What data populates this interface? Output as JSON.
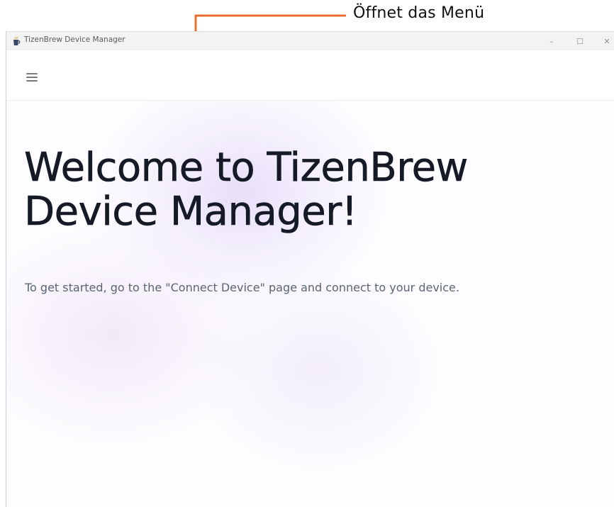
{
  "annotation": {
    "label": "Öffnet das Menü",
    "color": "#e8702f"
  },
  "window": {
    "title": "TizenBrew Device Manager",
    "controls": {
      "minimize": "–",
      "maximize": "☐",
      "close": "✕"
    }
  },
  "header": {
    "menu_icon": "hamburger-menu-icon"
  },
  "main": {
    "title": "Welcome to TizenBrew Device Manager!",
    "subtitle": "To get started, go to the \"Connect Device\" page and connect to your device."
  }
}
